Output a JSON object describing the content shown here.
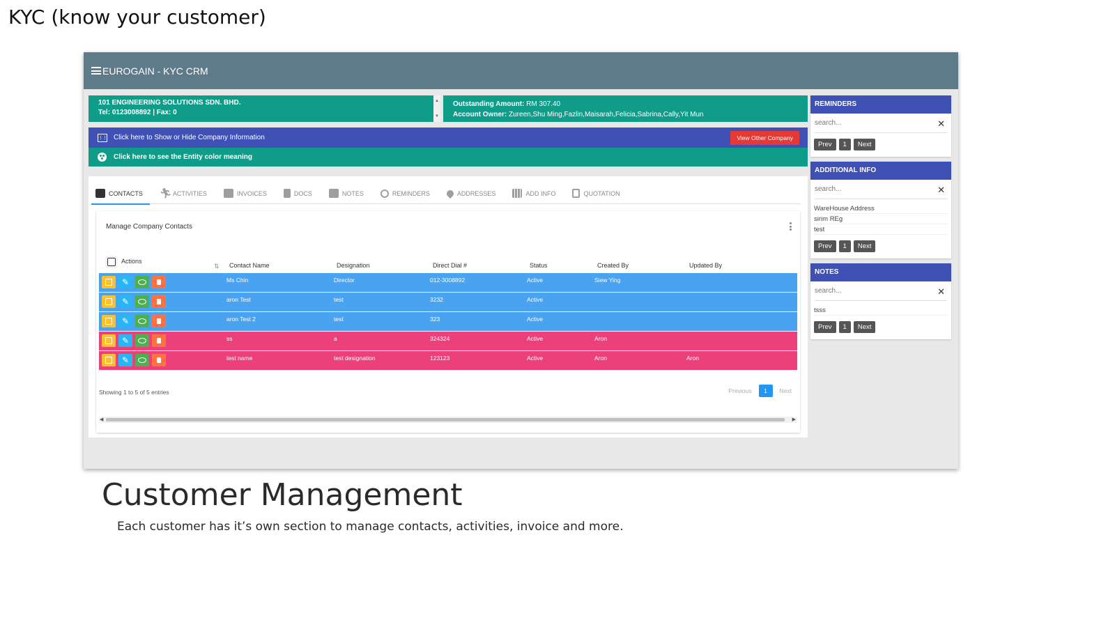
{
  "slide": {
    "title": "KYC (know your customer)",
    "section_title": "Customer Management",
    "section_subtitle": "Each customer has it’s own section to manage contacts, activities, invoice and more."
  },
  "app": {
    "title": "EUROGAIN - KYC CRM"
  },
  "company": {
    "name": "101 ENGINEERING SOLUTIONS SDN. BHD.",
    "contact": "Tel: 0123008892 | Fax: 0",
    "outstanding_label": "Outstanding Amount:",
    "outstanding_value": "RM 307.40",
    "owner_label": "Account Owner:",
    "owner_value": "Zureen,Shu Ming,Fazlin,Maisarah,Felicia,Sabrina,Cally,Yit Mun"
  },
  "info_bar": {
    "toggle_label": "Click here to Show or Hide Company Information",
    "view_other_label": "View Other Company",
    "color_meaning_label": "Click here to see the Entity color meaning"
  },
  "tabs": [
    {
      "label": "CONTACTS",
      "icon": "contact-card-icon"
    },
    {
      "label": "ACTIVITIES",
      "icon": "running-person-icon"
    },
    {
      "label": "INVOICES",
      "icon": "mail-icon"
    },
    {
      "label": "DOCS",
      "icon": "document-icon"
    },
    {
      "label": "NOTES",
      "icon": "comment-icon"
    },
    {
      "label": "REMINDERS",
      "icon": "alarm-clock-icon"
    },
    {
      "label": "ADDRESSES",
      "icon": "location-pin-icon"
    },
    {
      "label": "ADD INFO",
      "icon": "grid-icon"
    },
    {
      "label": "QUOTATION",
      "icon": "clipboard-icon"
    }
  ],
  "contacts": {
    "panel_title": "Manage Company Contacts",
    "columns": {
      "actions": "Actions",
      "contact_name": "Contact Name",
      "designation": "Designation",
      "direct_dial": "Direct Dial #",
      "status": "Status",
      "created_by": "Created By",
      "updated_by": "Updated By"
    },
    "rows": [
      {
        "name": "Ms Chin",
        "designation": "Director",
        "dial": "012-3008892",
        "status": "Active",
        "created_by": "Siew Ying",
        "updated_by": "",
        "color": "#4aa3f0"
      },
      {
        "name": "aron Test",
        "designation": "test",
        "dial": "3232",
        "status": "Active",
        "created_by": "",
        "updated_by": "",
        "color": "#4aa3f0"
      },
      {
        "name": "aron Test 2",
        "designation": "test",
        "dial": "323",
        "status": "Active",
        "created_by": "",
        "updated_by": "",
        "color": "#4aa3f0"
      },
      {
        "name": "ss",
        "designation": "a",
        "dial": "324324",
        "status": "Active",
        "created_by": "Aron",
        "updated_by": "",
        "color": "#ec407a"
      },
      {
        "name": "test name",
        "designation": "test designation",
        "dial": "123123",
        "status": "Active",
        "created_by": "Aron",
        "updated_by": "Aron",
        "color": "#ec407a"
      }
    ],
    "showing": "Showing 1 to 5 of 5 entries",
    "pager": {
      "previous": "Previous",
      "page": "1",
      "next": "Next"
    }
  },
  "reminders": {
    "title": "REMINDERS",
    "search_placeholder": "search...",
    "pager": {
      "prev": "Prev",
      "page": "1",
      "next": "Next"
    }
  },
  "additional_info": {
    "title": "ADDITIONAL INFO",
    "search_placeholder": "search...",
    "items": [
      "WareHouse Address",
      "sirim REg",
      "test"
    ],
    "pager": {
      "prev": "Prev",
      "page": "1",
      "next": "Next"
    }
  },
  "notes": {
    "title": "NOTES",
    "search_placeholder": "search...",
    "items": [
      "tsss"
    ],
    "pager": {
      "prev": "Prev",
      "page": "1",
      "next": "Next"
    }
  },
  "colors": {
    "topbar": "#5f7b8a",
    "teal": "#0f9d8a",
    "indigo": "#3f51b5",
    "row_blue": "#4aa3f0",
    "row_pink": "#ec407a",
    "accent_red": "#e53935",
    "accent_blue": "#2196f3"
  }
}
